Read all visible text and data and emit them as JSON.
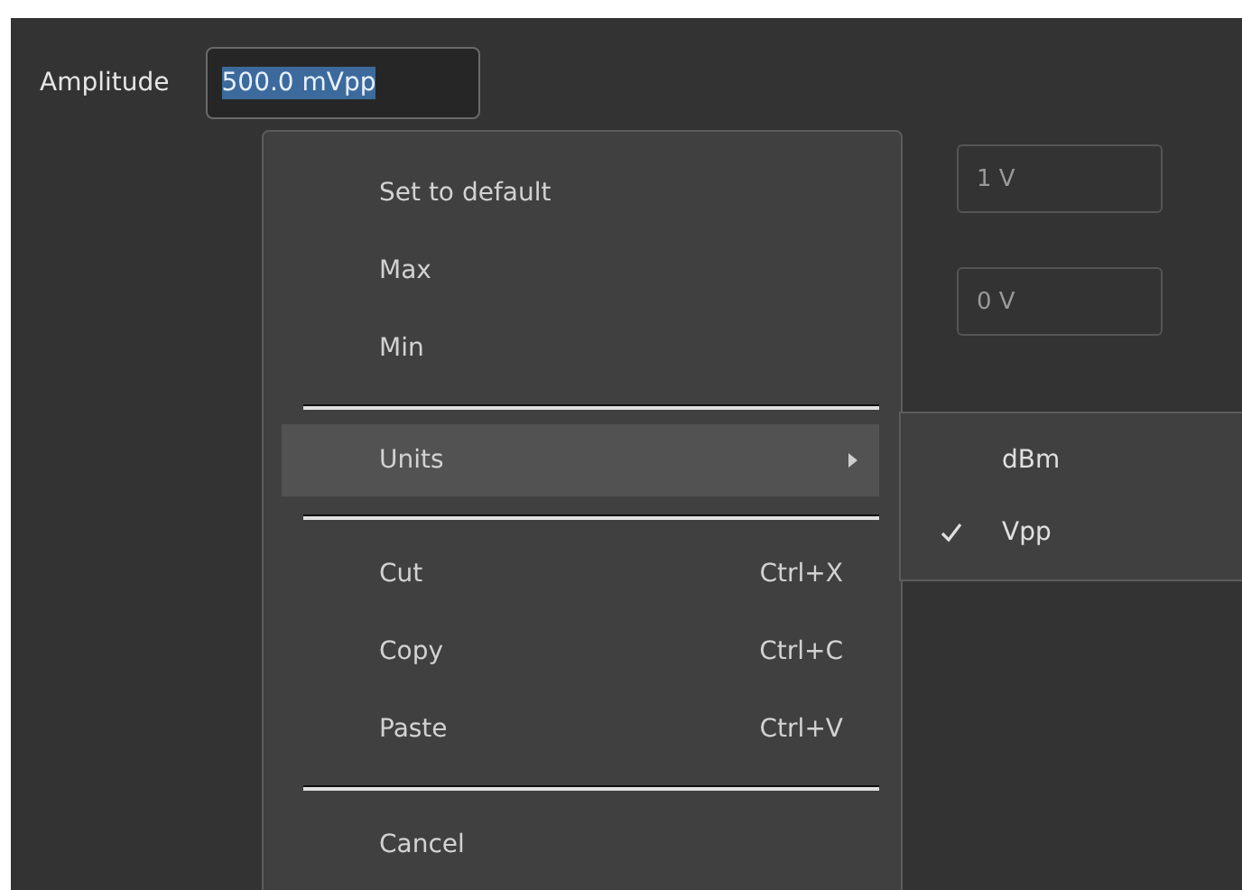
{
  "amplitude": {
    "label": "Amplitude",
    "value": "500.0 mVpp"
  },
  "fields": [
    {
      "value": "1 V"
    },
    {
      "value": "0 V"
    }
  ],
  "context_menu": {
    "items": [
      {
        "kind": "item",
        "label": "Set to default",
        "selected": false
      },
      {
        "kind": "item",
        "label": "Max",
        "selected": false
      },
      {
        "kind": "item",
        "label": "Min",
        "selected": false
      },
      {
        "kind": "separator"
      },
      {
        "kind": "submenu",
        "label": "Units",
        "selected": true
      },
      {
        "kind": "separator"
      },
      {
        "kind": "item",
        "label": "Cut",
        "shortcut": "Ctrl+X",
        "selected": false
      },
      {
        "kind": "item",
        "label": "Copy",
        "shortcut": "Ctrl+C",
        "selected": false
      },
      {
        "kind": "item",
        "label": "Paste",
        "shortcut": "Ctrl+V",
        "selected": false
      },
      {
        "kind": "separator"
      },
      {
        "kind": "item",
        "label": "Cancel",
        "selected": false
      }
    ]
  },
  "units_submenu": {
    "items": [
      {
        "label": "dBm",
        "checked": false
      },
      {
        "label": "Vpp",
        "checked": true
      }
    ]
  }
}
